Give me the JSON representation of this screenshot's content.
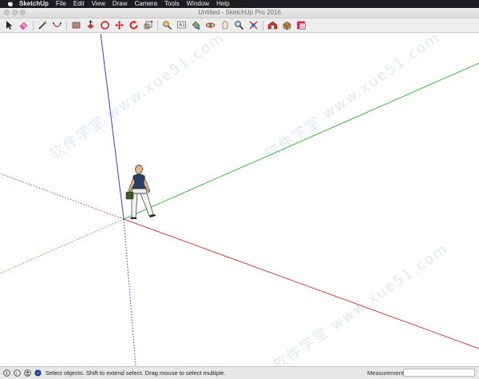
{
  "menubar": {
    "apple_icon": "apple-icon",
    "items": [
      "SketchUp",
      "File",
      "Edit",
      "View",
      "Draw",
      "Camera",
      "Tools",
      "Window",
      "Help"
    ]
  },
  "window": {
    "title": "Untitled - SketchUp Pro 2016"
  },
  "toolbar": {
    "tools": [
      {
        "icon": "select-arrow-icon"
      },
      {
        "icon": "eraser-icon"
      },
      {
        "icon": "line-pencil-icon"
      },
      {
        "icon": "arc-icon"
      },
      {
        "icon": "rectangle-icon"
      },
      {
        "icon": "push-pull-icon"
      },
      {
        "icon": "follow-me-icon"
      },
      {
        "icon": "move-icon"
      },
      {
        "icon": "rotate-icon"
      },
      {
        "icon": "scale-icon"
      },
      {
        "icon": "tape-measure-icon"
      },
      {
        "icon": "text-icon"
      },
      {
        "icon": "paint-bucket-icon"
      },
      {
        "icon": "orbit-icon"
      },
      {
        "icon": "pan-icon"
      },
      {
        "icon": "zoom-icon"
      },
      {
        "icon": "zoom-extents-icon"
      },
      {
        "icon": "warehouse-icon"
      },
      {
        "icon": "extension-warehouse-icon"
      },
      {
        "icon": "layout-icon"
      }
    ]
  },
  "watermark": {
    "text": "软件学堂 www.xue51.com"
  },
  "status": {
    "icons": [
      "info-icon",
      "credits-icon",
      "user-icon",
      "geolocation-icon"
    ],
    "message": "Select objects. Shift to extend select. Drag mouse to select multiple.",
    "measurements_label": "Measurements",
    "measurements_value": ""
  },
  "colors": {
    "red_axis": "#d23c3c",
    "green_axis": "#3cb83c",
    "blue_axis": "#3c3cd8"
  }
}
